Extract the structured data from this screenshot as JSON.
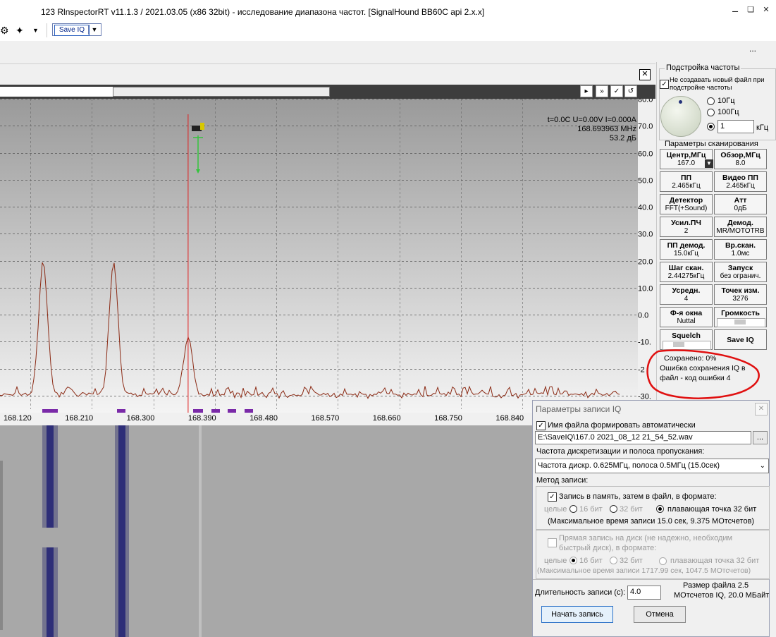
{
  "window": {
    "title": "123 RlnspectorRT v11.1.3 / 2021.03.05 (x86 32bit) - исследование диапазона частот. [SignalHound BB60C api 2.x.x]"
  },
  "toolbar": {
    "save_iq_label": "Save IQ",
    "overflow": "..."
  },
  "spectrum": {
    "readout_line1": "t=0.0C U=0.00V I=0.000A",
    "readout_line2": "168.693963 MHz",
    "readout_line3": "53.2 дБ",
    "y_ticks": [
      "80.0",
      "70.0",
      "60.0",
      "50.0",
      "40.0",
      "30.0",
      "20.0",
      "10.0",
      "0.0",
      "-10.",
      "-2",
      "-30."
    ],
    "x_ticks": [
      "168.120",
      "168.210",
      "168.300",
      "168.390",
      "168.480",
      "168.570",
      "168.660",
      "168.750",
      "168.840"
    ]
  },
  "chart_data": {
    "type": "line",
    "x_unit": "MHz",
    "y_unit": "дБ",
    "xlim": [
      168.1,
      168.92
    ],
    "ylim": [
      -35,
      80
    ],
    "x_ticks": [
      168.12,
      168.21,
      168.3,
      168.39,
      168.48,
      168.57,
      168.66,
      168.75,
      168.84
    ],
    "grid": true,
    "marker_x": 168.39,
    "peaks": [
      {
        "x": 168.178,
        "y": 20
      },
      {
        "x": 168.281,
        "y": 20
      },
      {
        "x": 168.39,
        "y": -8
      }
    ],
    "noise_floor": -30
  },
  "tuning": {
    "title": "Подстройка частоты",
    "no_new_file_label": "Не создавать новый файл при подстройке частоты",
    "step_10": "10Гц",
    "step_100": "100Гц",
    "step_custom_value": "1",
    "step_unit": "кГц"
  },
  "scan": {
    "title": "Параметры сканирования",
    "buttons": [
      {
        "t": "Центр,МГц",
        "v": "167.0"
      },
      {
        "t": "Обзор,МГц",
        "v": "8.0"
      },
      {
        "t": "ПП",
        "v": "2.465кГц"
      },
      {
        "t": "Видео ПП",
        "v": "2.465кГц"
      },
      {
        "t": "Детектор",
        "v": "FFT(+Sound)"
      },
      {
        "t": "Атт",
        "v": "0дБ"
      },
      {
        "t": "Усил.ПЧ",
        "v": "2"
      },
      {
        "t": "Демод.",
        "v": "MR/MOTOTRB"
      },
      {
        "t": "ПП демод.",
        "v": "15.0кГц"
      },
      {
        "t": "Вр.скан.",
        "v": "1.0мс"
      },
      {
        "t": "Шаг скан.",
        "v": "2.44275кГц"
      },
      {
        "t": "Запуск",
        "v": "без огранич."
      },
      {
        "t": "Усредн.",
        "v": "4"
      },
      {
        "t": "Точек изм.",
        "v": "3276"
      },
      {
        "t": "Ф-я окна",
        "v": "Nuttal"
      },
      {
        "t": "Громкость",
        "v": ""
      },
      {
        "t": "Squelch",
        "v": ""
      },
      {
        "t": "Save IQ",
        "v": ""
      }
    ]
  },
  "status": {
    "saved": "Сохранено:  0%",
    "error": "Ошибка сохранения IQ в файл  - код ошибки 4"
  },
  "dialog": {
    "title": "Параметры записи IQ",
    "auto_name_label": "Имя файла формировать автоматически",
    "file_path": "E:\\SaveIQ\\167.0 2021_08_12  21_54_52.wav",
    "browse_label": "...",
    "sample_rate_label": "Частота дискретизации и полоса пропускания:",
    "sample_rate_value": "Частота дискр. 0.625МГц, полоса 0.5МГц (15.0сек)",
    "method_label": "Метод записи:",
    "mem_option_label": "Запись в память, затем в файл, в формате:",
    "int_label": "целые",
    "bit16": "16 бит",
    "bit32": "32 бит",
    "float32": "плавающая точка 32 бит",
    "mem_max": "(Максимальное время записи 15.0 сек, 9.375 МОтсчетов)",
    "disk_option_label_1": "Прямая запись на диск (не надежно, необходим",
    "disk_option_label_2": "быстрый диск), в формате:",
    "disk_int_label": "целые",
    "disk_bit16": "16 бит",
    "disk_bit32": "32 бит",
    "disk_float32": "плавающая точка 32 бит",
    "disk_max": "(Максимальное время записи 1717.99 сек, 1047.5 МОтсчетов)",
    "duration_label": "Длительность записи (с):",
    "duration_value": "4.0",
    "size_line1": "Размер файла 2.5",
    "size_line2": "МОтсчетов IQ, 20.0 МБайт",
    "start_label": "Начать запись",
    "cancel_label": "Отмена"
  },
  "colors": {
    "trace": "#8b2a14",
    "marker_line": "#e02020",
    "waterfall_signal": "#3a3a80",
    "annotation": "#e01010"
  }
}
